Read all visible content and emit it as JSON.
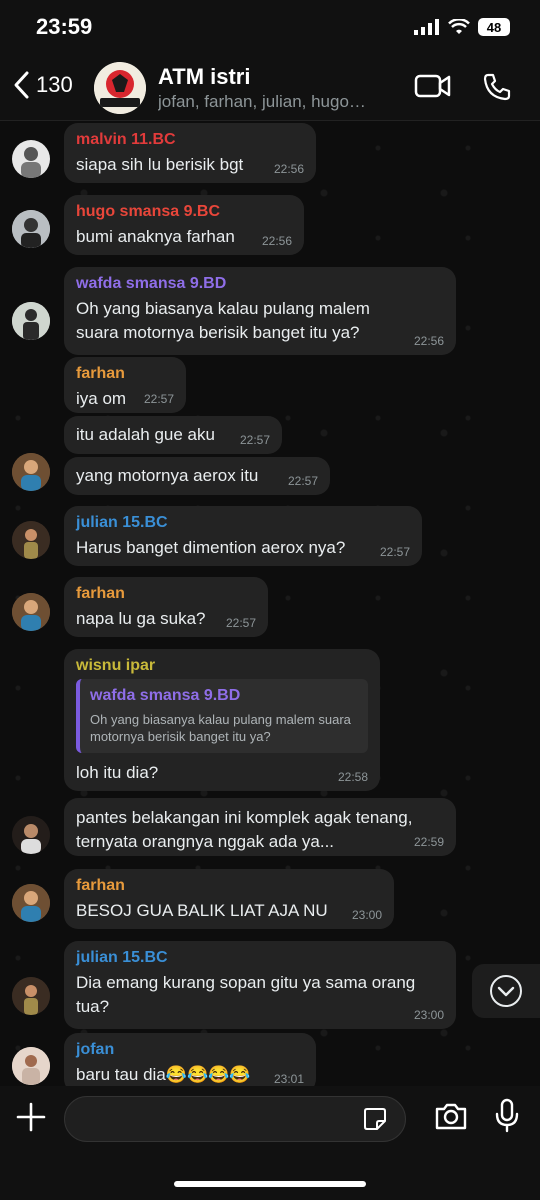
{
  "status": {
    "time": "23:59",
    "battery": "48"
  },
  "header": {
    "back_count": "130",
    "title": "ATM istri",
    "members": "jofan, farhan, julian, hugo…"
  },
  "messages": [
    {
      "sender": "malvin 11.BC",
      "sender_color": "#e23b3b",
      "text": "siapa sih lu berisik bgt",
      "time": "22:56"
    },
    {
      "sender": "hugo smansa 9.BC",
      "sender_color": "#e8463a",
      "text": "bumi anaknya farhan",
      "time": "22:56"
    },
    {
      "sender": "wafda smansa 9.BD",
      "sender_color": "#8f6ee8",
      "text": "Oh yang biasanya kalau pulang malem suara motornya berisik banget itu ya?",
      "time": "22:56"
    },
    {
      "sender": "farhan",
      "sender_color": "#e79a3c",
      "text": "iya om",
      "time": "22:57"
    },
    {
      "sender": "",
      "sender_color": "",
      "text": "itu adalah gue aku",
      "time": "22:57"
    },
    {
      "sender": "",
      "sender_color": "",
      "text": "yang motornya aerox itu",
      "time": "22:57"
    },
    {
      "sender": "julian 15.BC",
      "sender_color": "#3a8fd6",
      "text": "Harus banget dimention aerox nya?",
      "time": "22:57"
    },
    {
      "sender": "farhan",
      "sender_color": "#e79a3c",
      "text": "napa lu ga suka?",
      "time": "22:57"
    },
    {
      "sender": "wisnu ipar",
      "sender_color": "#c8b93a",
      "text": "loh itu dia?",
      "time": "22:58",
      "quote": {
        "sender": "wafda smansa 9.BD",
        "text": "Oh yang biasanya kalau pulang malem suara motornya berisik banget itu ya?"
      }
    },
    {
      "sender": "",
      "sender_color": "",
      "text": "pantes belakangan ini komplek agak tenang, ternyata orangnya nggak ada ya...",
      "time": "22:59"
    },
    {
      "sender": "farhan",
      "sender_color": "#e79a3c",
      "text": "BESOJ GUA BALIK LIAT AJA NU",
      "time": "23:00"
    },
    {
      "sender": "julian 15.BC",
      "sender_color": "#3a8fd6",
      "text": "Dia emang kurang sopan gitu ya sama orang tua?",
      "time": "23:00"
    },
    {
      "sender": "jofan",
      "sender_color": "#3a8fd6",
      "text": "baru tau dia😂😂😂😂",
      "time": "23:01"
    }
  ],
  "input": {
    "value": ""
  },
  "icons": [
    "back-chevron-icon",
    "video-call-icon",
    "phone-icon",
    "scroll-down-icon",
    "plus-icon",
    "sticker-icon",
    "camera-icon",
    "mic-icon"
  ]
}
